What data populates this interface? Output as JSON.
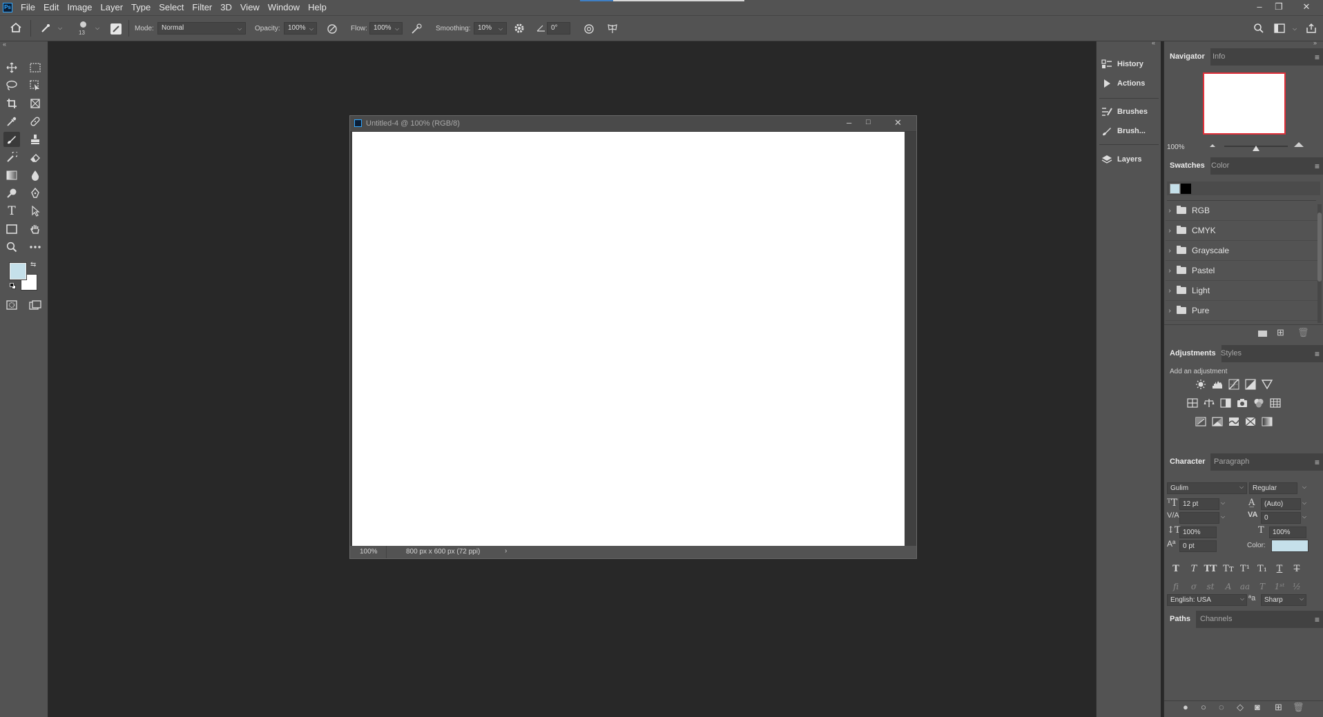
{
  "menubar": {
    "logo": "Ps",
    "items": [
      "File",
      "Edit",
      "Image",
      "Layer",
      "Type",
      "Select",
      "Filter",
      "3D",
      "View",
      "Window",
      "Help"
    ]
  },
  "options": {
    "brush_size": "13",
    "mode_label": "Mode:",
    "mode_value": "Normal",
    "opacity_label": "Opacity:",
    "opacity_value": "100%",
    "flow_label": "Flow:",
    "flow_value": "100%",
    "smoothing_label": "Smoothing:",
    "smoothing_value": "10%",
    "angle_value": "0°"
  },
  "colors": {
    "foreground": "#c5e0ea",
    "background": "#ffffff",
    "accent": "#31a8ff"
  },
  "document": {
    "title": "Untitled-4 @ 100% (RGB/8)",
    "zoom": "100%",
    "info": "800 px x 600 px (72 ppi)"
  },
  "dock_mid": {
    "items": [
      "History",
      "Actions",
      "Brushes",
      "Brush...",
      "Layers"
    ]
  },
  "navigator": {
    "tabs": [
      "Navigator",
      "Info"
    ],
    "zoom": "100%"
  },
  "swatches": {
    "tabs": [
      "Swatches",
      "Color"
    ],
    "folders": [
      "RGB",
      "CMYK",
      "Grayscale",
      "Pastel",
      "Light",
      "Pure"
    ]
  },
  "adjustments": {
    "tabs": [
      "Adjustments",
      "Styles"
    ],
    "hint": "Add an adjustment"
  },
  "character": {
    "tabs": [
      "Character",
      "Paragraph"
    ],
    "font_family": "Gulim",
    "font_style": "Regular",
    "size": "12 pt",
    "leading": "(Auto)",
    "kerning": "",
    "tracking": "0",
    "vscale": "100%",
    "hscale": "100%",
    "baseline": "0 pt",
    "color_label": "Color:",
    "language": "English: USA",
    "antialias": "Sharp"
  },
  "paths": {
    "tabs": [
      "Paths",
      "Channels"
    ]
  }
}
